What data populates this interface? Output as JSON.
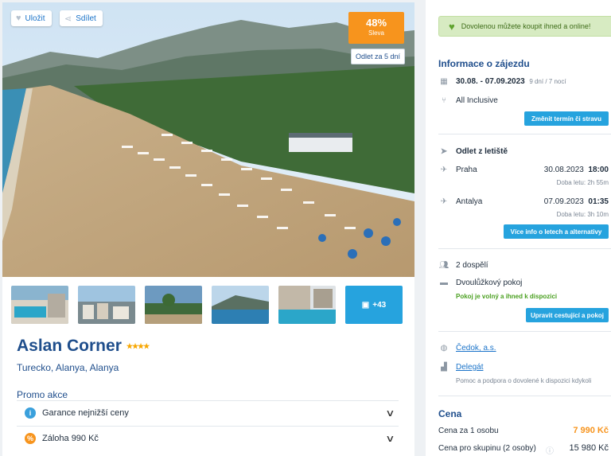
{
  "hero": {
    "save_label": "Uložit",
    "share_label": "Sdílet",
    "discount_pct": "48%",
    "discount_label": "Sleva",
    "departure_chip": "Odlet za 5 dní"
  },
  "gallery": {
    "more_label": "+43"
  },
  "hotel": {
    "name": "Aslan Corner",
    "stars": "★★★★",
    "location": "Turecko, Alanya, Alanya"
  },
  "promo": {
    "heading": "Promo akce",
    "items": [
      {
        "label": "Garance nejnižší ceny",
        "icon": "info-icon",
        "color": "#3aa0dc",
        "glyph": "i"
      },
      {
        "label": "Záloha 990 Kč",
        "icon": "percent-icon",
        "color": "#f7941d",
        "glyph": "%"
      }
    ]
  },
  "sidebar": {
    "banner": "Dovolenou můžete koupit ihned a online!",
    "info_heading": "Informace o zájezdu",
    "dates": "30.08. - 07.09.2023",
    "duration": "9 dní / 7 nocí",
    "board": "All Inclusive",
    "change_btn": "Změnit termín či stravu",
    "departure_heading": "Odlet z letiště",
    "flights": [
      {
        "city": "Praha",
        "date": "30.08.2023",
        "time": "18:00",
        "duration": "Doba letu: 2h 55m"
      },
      {
        "city": "Antalya",
        "date": "07.09.2023",
        "time": "01:35",
        "duration": "Doba letu: 3h 10m"
      }
    ],
    "flights_btn": "Více info o letech a alternativy",
    "travelers": "2 dospělí",
    "room": "Dvoulůžkový pokoj",
    "room_status": "Pokoj je volný a ihned k dispozici",
    "edit_btn": "Upravit cestující a pokoj",
    "agency": "Čedok, a.s.",
    "delegate": "Delegát",
    "delegate_desc": "Pomoc a podpora o dovolené k dispozici kdykoli",
    "price_heading": "Cena",
    "price_person_label": "Cena za 1 osobu",
    "price_person": "7 990 Kč",
    "price_group_label": "Cena pro skupinu (2 osoby)",
    "price_group": "15 980 Kč"
  },
  "colors": {
    "accent": "#26a3de",
    "brand": "#1f4e8c",
    "discount": "#f7941d",
    "price": "#f7941d"
  }
}
